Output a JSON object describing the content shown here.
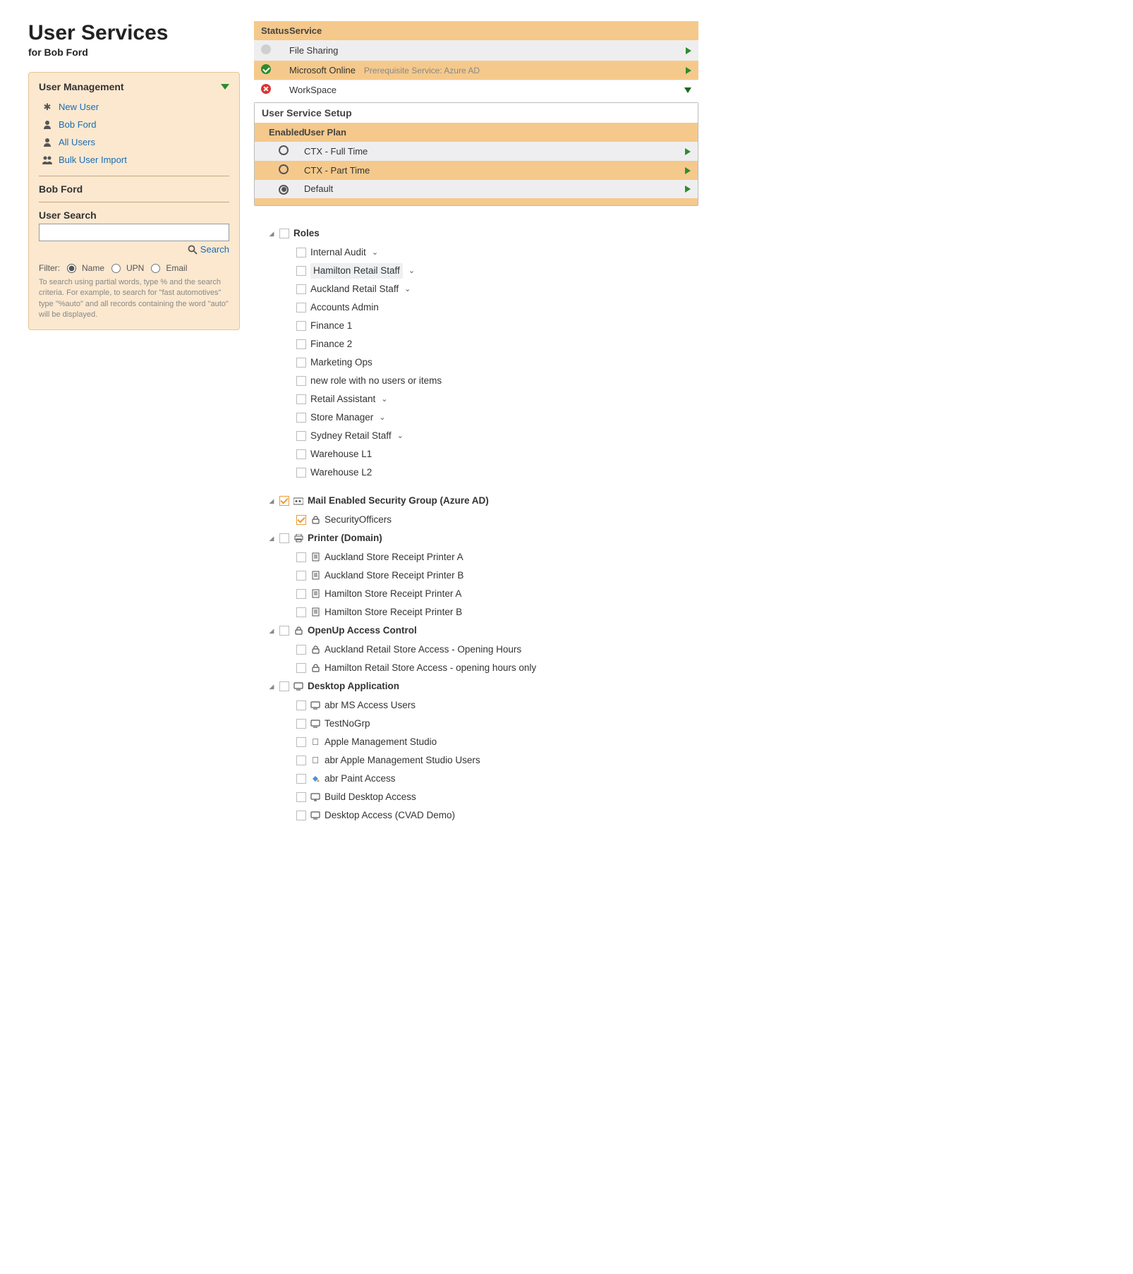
{
  "header": {
    "title": "User Services",
    "subtitle": "for Bob Ford"
  },
  "sidebar": {
    "panel_title": "User Management",
    "items": [
      {
        "label": "New User"
      },
      {
        "label": "Bob Ford"
      },
      {
        "label": "All Users"
      },
      {
        "label": "Bulk User Import"
      }
    ],
    "current_user": "Bob Ford",
    "search_title": "User Search",
    "search_value": "",
    "search_link": "Search",
    "filter_label": "Filter:",
    "filters": {
      "name": "Name",
      "upn": "UPN",
      "email": "Email"
    },
    "help": "To search using partial words, type % and the search criteria. For example, to search for \"fast automotives\" type \"%auto\" and all records containing the word \"auto\" will be displayed."
  },
  "services": {
    "head_status": "Status",
    "head_service": "Service",
    "rows": [
      {
        "name": "File Sharing",
        "status": "idle"
      },
      {
        "name": "Microsoft Online",
        "status": "ok",
        "prereq": "Prerequisite Service: Azure AD"
      },
      {
        "name": "WorkSpace",
        "status": "error"
      }
    ]
  },
  "setup": {
    "title": "User Service Setup",
    "head_enabled": "Enabled",
    "head_plan": "User Plan",
    "plans": [
      {
        "label": "CTX - Full Time",
        "selected": false
      },
      {
        "label": "CTX - Part Time",
        "selected": false
      },
      {
        "label": "Default",
        "selected": true
      }
    ]
  },
  "tree": {
    "roles_title": "Roles",
    "roles": [
      {
        "label": "Internal Audit",
        "chev": true
      },
      {
        "label": "Hamilton Retail Staff",
        "chev": true,
        "hl": true
      },
      {
        "label": "Auckland Retail Staff",
        "chev": true
      },
      {
        "label": "Accounts Admin"
      },
      {
        "label": "Finance 1"
      },
      {
        "label": "Finance 2"
      },
      {
        "label": "Marketing Ops"
      },
      {
        "label": "new role with no users or items"
      },
      {
        "label": "Retail Assistant",
        "chev": true
      },
      {
        "label": "Store Manager",
        "chev": true
      },
      {
        "label": "Sydney Retail Staff",
        "chev": true
      },
      {
        "label": "Warehouse L1"
      },
      {
        "label": "Warehouse L2"
      }
    ],
    "mesg_title": "Mail Enabled Security Group (Azure AD)",
    "mesg_items": [
      {
        "label": "SecurityOfficers",
        "icon": "lock",
        "checked": true
      }
    ],
    "printer_title": "Printer (Domain)",
    "printer_items": [
      {
        "label": "Auckland Store Receipt Printer A"
      },
      {
        "label": "Auckland Store Receipt Printer B"
      },
      {
        "label": "Hamilton Store Receipt Printer A"
      },
      {
        "label": "Hamilton Store Receipt Printer B"
      }
    ],
    "access_title": "OpenUp Access Control",
    "access_items": [
      {
        "label": "Auckland Retail Store Access - Opening Hours"
      },
      {
        "label": "Hamilton Retail Store Access - opening hours only"
      }
    ],
    "desktop_title": "Desktop Application",
    "desktop_items": [
      {
        "label": "abr MS Access Users",
        "icon": "monitor"
      },
      {
        "label": "TestNoGrp",
        "icon": "monitor"
      },
      {
        "label": "Apple Management Studio",
        "icon": "apple"
      },
      {
        "label": "abr Apple Management Studio Users",
        "icon": "apple"
      },
      {
        "label": "abr Paint Access",
        "icon": "paint"
      },
      {
        "label": "Build Desktop Access",
        "icon": "monitor2"
      },
      {
        "label": "Desktop Access (CVAD Demo)",
        "icon": "monitor"
      }
    ]
  }
}
